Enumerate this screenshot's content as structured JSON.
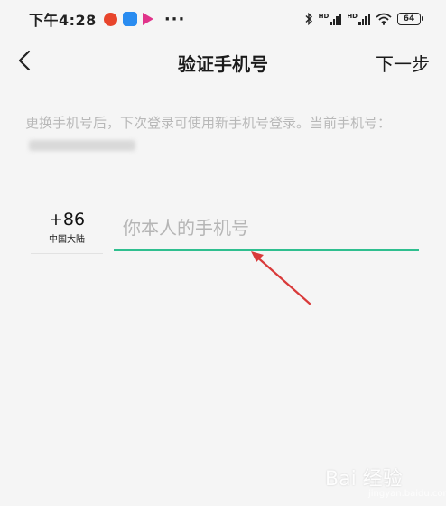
{
  "status_bar": {
    "time": "下午4:28",
    "more": "···",
    "battery": "64",
    "icons": [
      "location-app-icon",
      "chat-app-icon",
      "video-app-icon",
      "bluetooth-icon",
      "signal-icon",
      "signal-icon",
      "wifi-icon",
      "battery-icon"
    ]
  },
  "header": {
    "back_icon": "chevron-left-icon",
    "title": "验证手机号",
    "next_label": "下一步"
  },
  "notice": {
    "text": "更换手机号后，下次登录可使用新手机号登录。当前手机号："
  },
  "phone": {
    "country_code": "+86",
    "region": "中国大陆",
    "placeholder": "你本人的手机号",
    "value": ""
  },
  "annotation": {
    "arrow_color": "#d93a3a"
  },
  "accent_color": "#2fbf8f",
  "watermark": {
    "text": "Bai 经验",
    "sub": "jingyan.baidu.com"
  }
}
